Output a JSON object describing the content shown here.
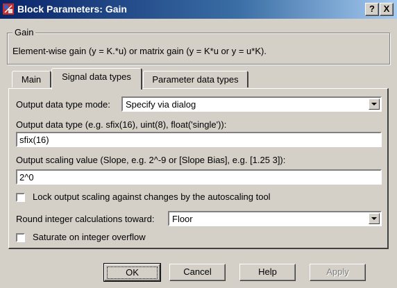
{
  "window": {
    "title": "Block Parameters: Gain",
    "help_btn": "?",
    "close_btn": "X"
  },
  "group": {
    "label": "Gain",
    "description": "Element-wise gain (y = K.*u) or matrix gain (y = K*u or y = u*K)."
  },
  "tabs": [
    {
      "label": "Main"
    },
    {
      "label": "Signal data types"
    },
    {
      "label": "Parameter data types"
    }
  ],
  "fields": {
    "mode_label": "Output data type mode:",
    "mode_value": "Specify via dialog",
    "type_label": "Output data type (e.g. sfix(16), uint(8), float('single')):",
    "type_value": "sfix(16)",
    "scaling_label": "Output scaling value (Slope, e.g. 2^-9 or [Slope Bias], e.g. [1.25 3]):",
    "scaling_value": "2^0",
    "lock_label": "Lock output scaling against changes by the autoscaling tool",
    "round_label": "Round integer calculations toward:",
    "round_value": "Floor",
    "saturate_label": "Saturate on integer overflow"
  },
  "buttons": {
    "ok": "OK",
    "cancel": "Cancel",
    "help": "Help",
    "apply": "Apply"
  }
}
